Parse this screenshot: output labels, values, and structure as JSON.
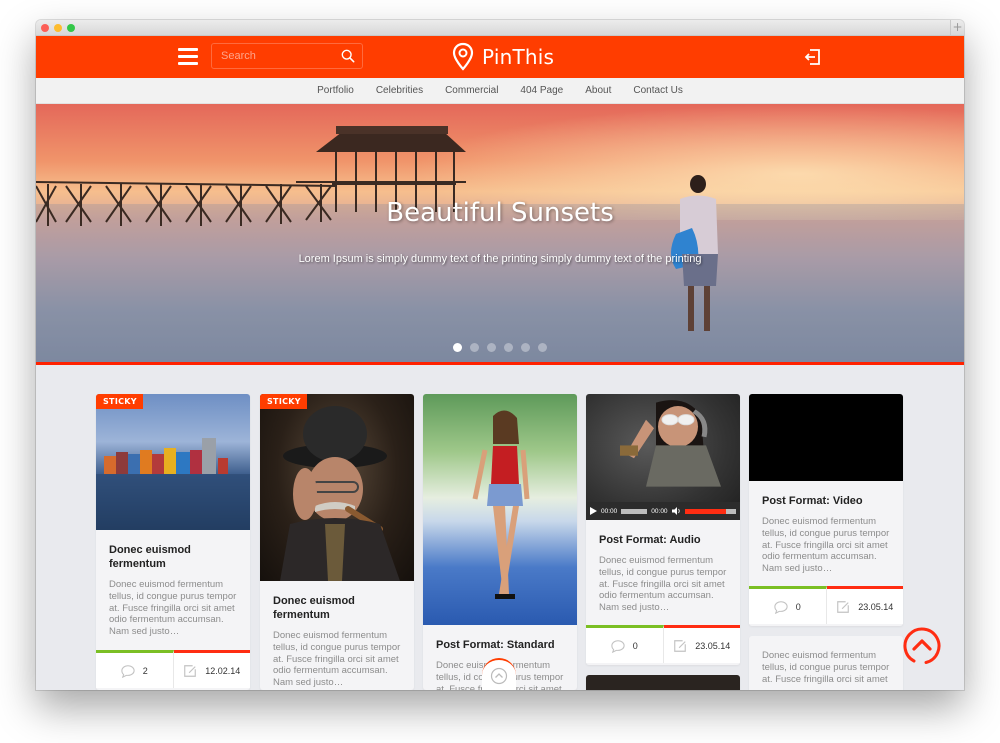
{
  "header": {
    "brand": "PinThis",
    "search_placeholder": "Search",
    "brand_color": "#ff3d00"
  },
  "nav": {
    "items": [
      "Portfolio",
      "Celebrities",
      "Commercial",
      "404 Page",
      "About",
      "Contact Us"
    ]
  },
  "hero": {
    "title": "Beautiful Sunsets",
    "subtitle": "Lorem Ipsum is simply dummy text of the printing simply dummy text of the printing",
    "slide_count": 6,
    "active_slide": 1
  },
  "cards": [
    {
      "badge": "STICKY",
      "title": "Donec euismod fermentum",
      "excerpt": "Donec euismod fermentum tellus, id congue purus tempor at. Fusce fringilla orci sit amet odio fermentum accumsan. Nam sed justo…",
      "comments": "2",
      "date": "12.02.14",
      "image": "colorful-waterfront-houses"
    },
    {
      "badge": "STICKY",
      "title": "Donec euismod fermentum",
      "excerpt": "Donec euismod fermentum tellus, id congue purus tempor at. Fusce fringilla orci sit amet odio fermentum accumsan. Nam sed justo…",
      "image": "man-with-bowler-hat-and-cigar"
    },
    {
      "title": "Post Format: Standard",
      "excerpt": "Donec euismod fermentum tellus, id congue purus tempor at. Fusce fringilla orci sit amet",
      "image": "woman-in-red-top-on-road"
    },
    {
      "title": "Post Format: Audio",
      "excerpt": "Donec euismod fermentum tellus, id congue purus tempor at. Fusce fringilla orci sit amet odio fermentum accumsan. Nam sed justo…",
      "comments": "0",
      "date": "23.05.14",
      "image": "woman-with-headphones",
      "audio": {
        "current_time": "00:00",
        "duration": "00:00",
        "volume": 0.8
      }
    },
    {
      "title": "Post Format: Video",
      "excerpt": "Donec euismod fermentum tellus, id congue purus tempor at. Fusce fringilla orci sit amet odio fermentum accumsan. Nam sed justo…",
      "comments": "0",
      "date": "23.05.14",
      "image": "video-player-black"
    },
    {
      "excerpt": "Donec euismod fermentum tellus, id congue purus tempor at. Fusce fringilla orci sit amet"
    }
  ],
  "icons": {
    "menu": "hamburger-icon",
    "search": "search-icon",
    "logo": "map-pin-icon",
    "logout": "logout-icon",
    "comment": "speech-bubble-icon",
    "date": "edit-icon",
    "scroll_top": "chevron-up-circle-icon"
  },
  "colors": {
    "accent": "#ff3d00",
    "comments_bar": "#7bbf24",
    "date_bar": "#ff2d12",
    "page_bg": "#e9eaee"
  }
}
